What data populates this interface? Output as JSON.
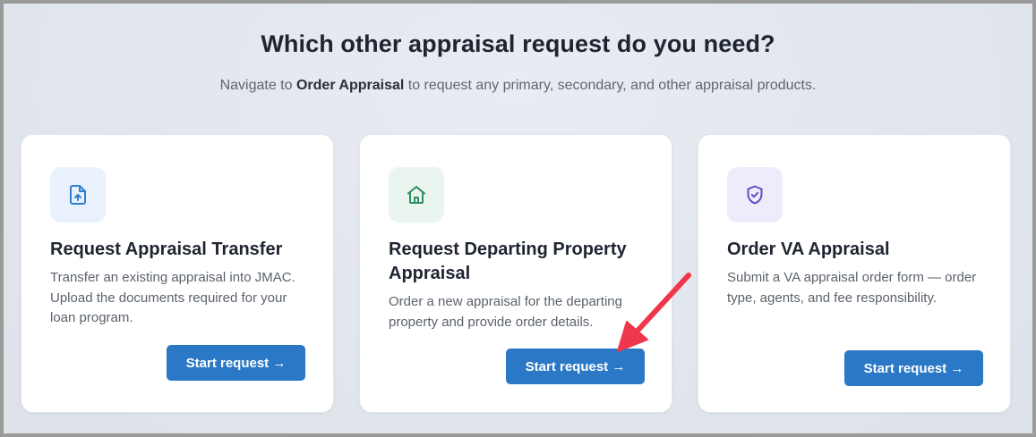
{
  "header": {
    "title": "Which other appraisal request do you need?",
    "subtitle_before": "Navigate to ",
    "subtitle_link": "Order Appraisal",
    "subtitle_after": " to request any primary, secondary, and other appraisal products."
  },
  "cards": [
    {
      "icon": "file-upload-icon",
      "title": "Request Appraisal Transfer",
      "description": "Transfer an existing appraisal into JMAC. Upload the documents required for your loan program.",
      "button_label": "Start request →"
    },
    {
      "icon": "home-icon",
      "title": "Request Departing Property Appraisal",
      "description": "Order a new appraisal for the departing property and provide order details.",
      "button_label": "Start request →"
    },
    {
      "icon": "shield-check-icon",
      "title": "Order VA Appraisal",
      "description": "Submit a VA appraisal order form — order type, agents, and fee responsibility.",
      "button_label": "Start request →"
    }
  ],
  "colors": {
    "primary_button": "#2b78c6",
    "annotation_arrow": "#f0364a",
    "icon_blue": "#2f7fd0",
    "icon_green": "#2e8f5f",
    "icon_purple": "#5b4fc2"
  }
}
